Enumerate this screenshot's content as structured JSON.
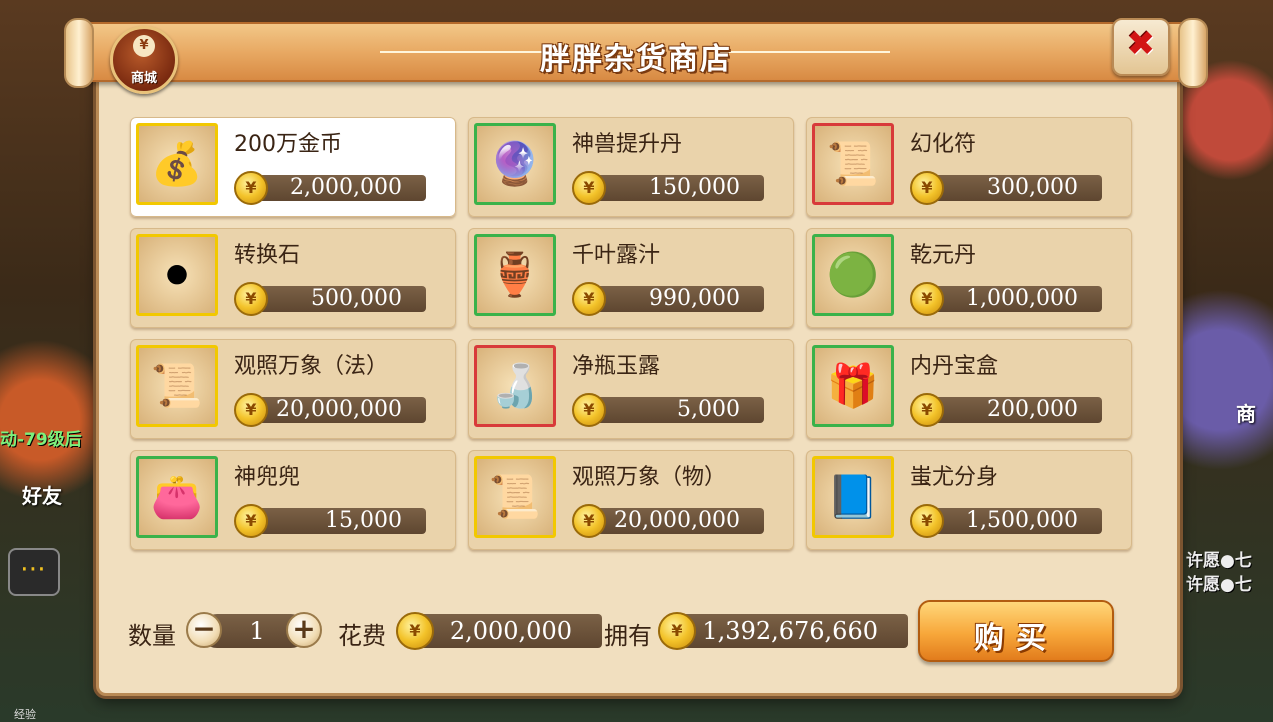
{
  "shop": {
    "title": "胖胖杂货商店",
    "badge_label": "商城",
    "badge_coin": "¥"
  },
  "items": [
    {
      "name": "200万金币",
      "price": "2,000,000",
      "icon": "treasure-chest-icon",
      "glyph": "💰",
      "frame": "gold",
      "selected": true
    },
    {
      "name": "神兽提升丹",
      "price": "150,000",
      "icon": "crystal-branch-icon",
      "glyph": "🔮",
      "frame": "green"
    },
    {
      "name": "幻化符",
      "price": "300,000",
      "icon": "talisman-icon",
      "glyph": "📜",
      "frame": "red"
    },
    {
      "name": "转换石",
      "price": "500,000",
      "icon": "dark-orb-icon",
      "glyph": "⚫",
      "frame": "gold"
    },
    {
      "name": "千叶露汁",
      "price": "990,000",
      "icon": "vase-plant-icon",
      "glyph": "🏺",
      "frame": "green"
    },
    {
      "name": "乾元丹",
      "price": "1,000,000",
      "icon": "green-pill-icon",
      "glyph": "🟢",
      "frame": "green"
    },
    {
      "name": "观照万象（法）",
      "price": "20,000,000",
      "icon": "scroll-icon",
      "glyph": "📜",
      "frame": "gold"
    },
    {
      "name": "净瓶玉露",
      "price": "5,000",
      "icon": "jade-bottle-icon",
      "glyph": "🍶",
      "frame": "red"
    },
    {
      "name": "内丹宝盒",
      "price": "200,000",
      "icon": "gift-box-icon",
      "glyph": "🎁",
      "frame": "green"
    },
    {
      "name": "神兜兜",
      "price": "15,000",
      "icon": "pouch-icon",
      "glyph": "👛",
      "frame": "green"
    },
    {
      "name": "观照万象（物）",
      "price": "20,000,000",
      "icon": "scroll-icon",
      "glyph": "📜",
      "frame": "gold"
    },
    {
      "name": "蚩尤分身",
      "price": "1,500,000",
      "icon": "blue-book-icon",
      "glyph": "📘",
      "frame": "gold"
    }
  ],
  "bottom": {
    "qty_label": "数量",
    "qty_value": "1",
    "minus": "−",
    "plus": "+",
    "cost_label": "花费",
    "cost_value": "2,000,000",
    "own_label": "拥有",
    "own_value": "1,392,676,660",
    "buy_label": "购买"
  },
  "close_symbol": "✖",
  "background": {
    "left_text": "动-79级后",
    "friend": "好友",
    "wish1": "许愿●七",
    "wish2": "许愿●七",
    "shop_side": "商",
    "exp": "经验"
  },
  "colors": {
    "price_bar": "#6a5038",
    "accent_orange": "#f7a73a",
    "gold_frame": "#f2c800",
    "green_frame": "#3ab24a",
    "red_frame": "#d83a3a"
  }
}
